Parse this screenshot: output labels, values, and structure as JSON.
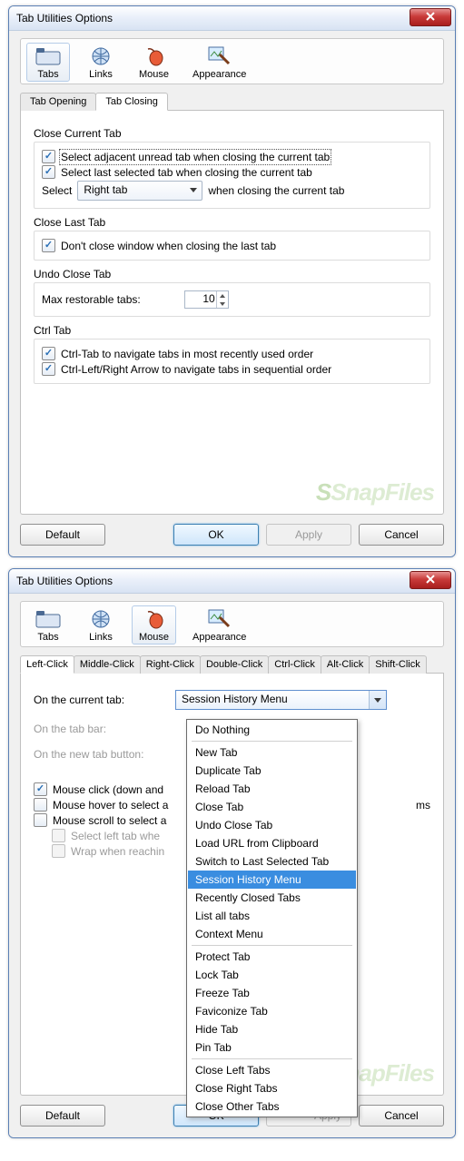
{
  "window_title": "Tab Utilities Options",
  "icon_tabs": {
    "tabs": "Tabs",
    "links": "Links",
    "mouse": "Mouse",
    "appearance": "Appearance"
  },
  "win1": {
    "selected_icon_tab": 0,
    "subtabs": {
      "opening": "Tab Opening",
      "closing": "Tab Closing"
    },
    "active_subtab": "closing",
    "close_current": {
      "title": "Close Current Tab",
      "chk1": "Select adjacent unread tab when closing the current tab",
      "chk2": "Select last selected tab when closing the current tab",
      "select_label": "Select",
      "select_value": "Right tab",
      "after_select": "when closing the current tab"
    },
    "close_last": {
      "title": "Close Last Tab",
      "chk1": "Don't close window when closing the last tab"
    },
    "undo": {
      "title": "Undo Close Tab",
      "label": "Max restorable tabs:",
      "value": "10"
    },
    "ctrl": {
      "title": "Ctrl Tab",
      "chk1": "Ctrl-Tab to navigate tabs in most recently used order",
      "chk2": "Ctrl-Left/Right Arrow to navigate tabs in sequential order"
    }
  },
  "win2": {
    "selected_icon_tab": 2,
    "subtabs": [
      "Left-Click",
      "Middle-Click",
      "Right-Click",
      "Double-Click",
      "Ctrl-Click",
      "Alt-Click",
      "Shift-Click"
    ],
    "active_subtab": 0,
    "rows": {
      "r1_label": "On the current tab:",
      "r1_value": "Session History Menu",
      "r2_label": "On the tab bar:",
      "r3_label": "On the new tab button:"
    },
    "checks": {
      "c1": "Mouse click (down and",
      "c2": "Mouse hover to select a",
      "c2_suffix": "ms",
      "c3": "Mouse scroll to select a",
      "c4": "Select left tab whe",
      "c5": "Wrap when reachin"
    },
    "dropdown_items": [
      "Do Nothing",
      "",
      "New Tab",
      "Duplicate Tab",
      "Reload Tab",
      "Close Tab",
      "Undo Close Tab",
      "Load URL from Clipboard",
      "Switch to Last Selected Tab",
      "Session History Menu",
      "Recently Closed Tabs",
      "List all tabs",
      "Context Menu",
      "",
      "Protect Tab",
      "Lock Tab",
      "Freeze Tab",
      "Faviconize Tab",
      "Hide Tab",
      "Pin Tab",
      "",
      "Close Left Tabs",
      "Close Right Tabs",
      "Close Other Tabs"
    ],
    "dropdown_highlight": "Session History Menu"
  },
  "buttons": {
    "default": "Default",
    "ok": "OK",
    "apply": "Apply",
    "cancel": "Cancel"
  },
  "watermark": "SnapFiles"
}
